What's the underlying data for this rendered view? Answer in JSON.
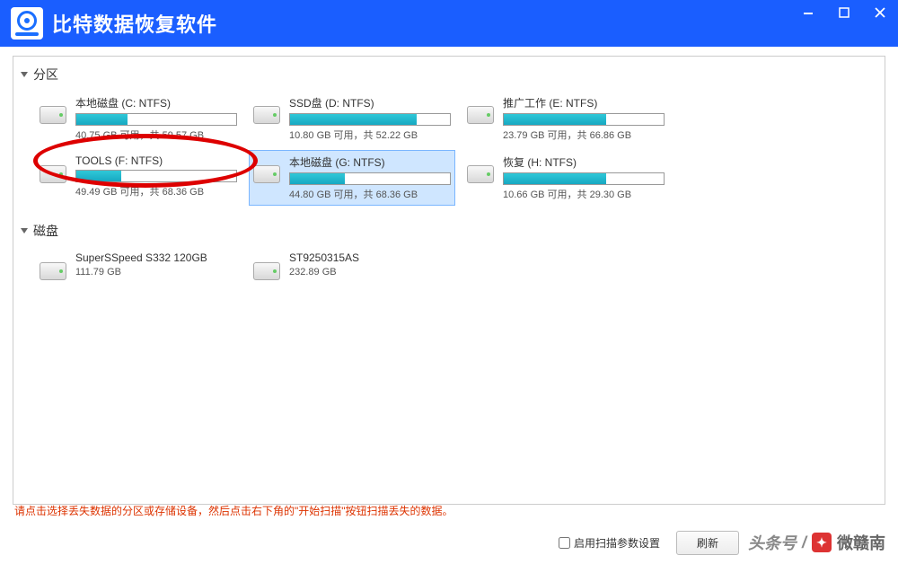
{
  "header": {
    "app_title": "比特数据恢复软件"
  },
  "sections": {
    "partitions_label": "分区",
    "disks_label": "磁盘"
  },
  "partitions": [
    {
      "name": "本地磁盘 (C: NTFS)",
      "stats": "40.75 GB 可用，共 59.57 GB",
      "used_pct": 32
    },
    {
      "name": "SSD盘 (D: NTFS)",
      "stats": "10.80 GB 可用，共 52.22 GB",
      "used_pct": 79
    },
    {
      "name": "推广工作 (E: NTFS)",
      "stats": "23.79 GB 可用，共 66.86 GB",
      "used_pct": 64
    },
    {
      "name": "TOOLS (F: NTFS)",
      "stats": "49.49 GB 可用，共 68.36 GB",
      "used_pct": 28
    },
    {
      "name": "本地磁盘 (G: NTFS)",
      "stats": "44.80 GB 可用，共 68.36 GB",
      "used_pct": 34,
      "selected": true
    },
    {
      "name": "恢复 (H: NTFS)",
      "stats": "10.66 GB 可用，共 29.30 GB",
      "used_pct": 64
    }
  ],
  "disks": [
    {
      "name": "SuperSSpeed S332 120GB",
      "stats": "111.79 GB"
    },
    {
      "name": "ST9250315AS",
      "stats": "232.89 GB"
    }
  ],
  "footer": {
    "hint": "请点击选择丢失数据的分区或存储设备，然后点击右下角的\"开始扫描\"按钮扫描丢失的数据。",
    "checkbox_label": "启用扫描参数设置",
    "refresh_label": "刷新"
  },
  "watermark": {
    "src": "头条号",
    "sep": "/",
    "name": "微赣南"
  }
}
